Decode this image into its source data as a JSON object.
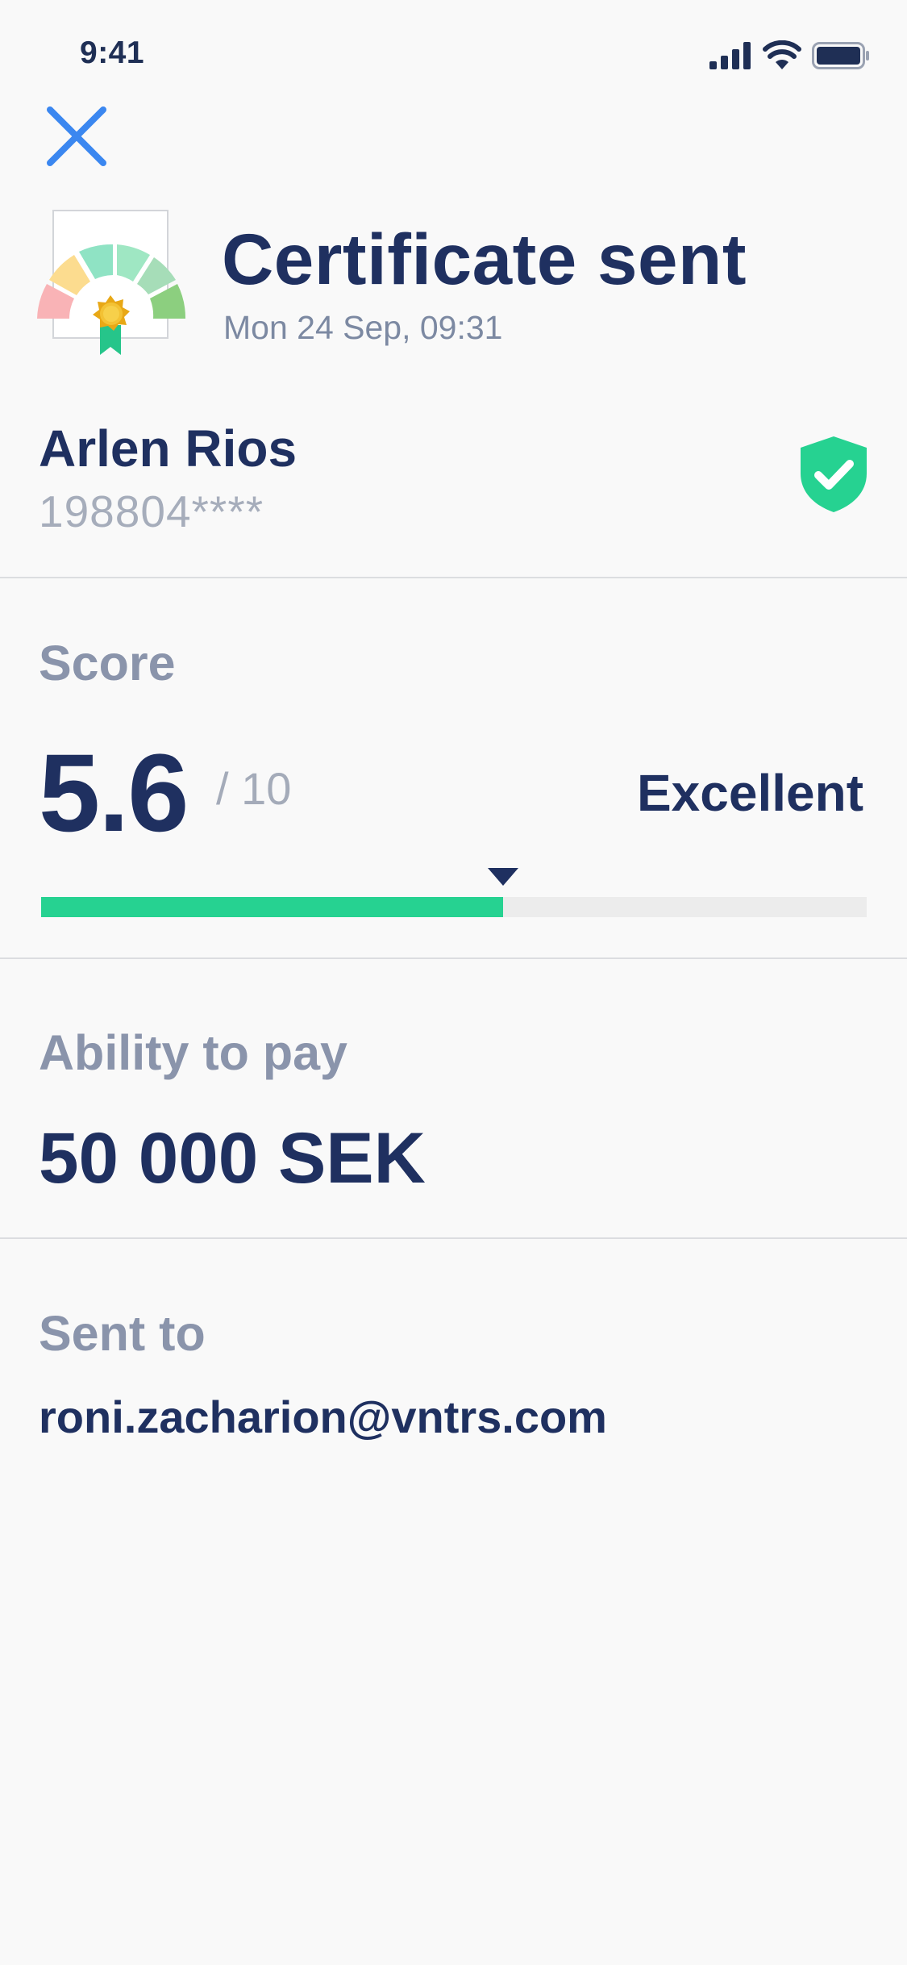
{
  "status_bar": {
    "time": "9:41",
    "icons": [
      "signal-icon",
      "wifi-icon",
      "battery-icon"
    ]
  },
  "navigation": {
    "close_icon": "close-icon"
  },
  "header": {
    "title": "Certificate sent",
    "date": "Mon 24 Sep, 09:31",
    "illustration": "certificate-gauge-illustration"
  },
  "person": {
    "name": "Arlen Rios",
    "id_masked": "198804****",
    "verified_icon": "shield-check-icon"
  },
  "score": {
    "label": "Score",
    "value": "5.6",
    "max": "/ 10",
    "rating": "Excellent",
    "progress_fraction": 0.56
  },
  "ability": {
    "label": "Ability to pay",
    "value": "50 000 SEK"
  },
  "sent_to": {
    "label": "Sent to",
    "email": "roni.zacharion@vntrs.com"
  },
  "colors": {
    "primary_text": "#1f3060",
    "muted_text": "#8a94ab",
    "accent_blue": "#3b87f0",
    "success_green": "#26d291",
    "background": "#f9f9f9"
  }
}
